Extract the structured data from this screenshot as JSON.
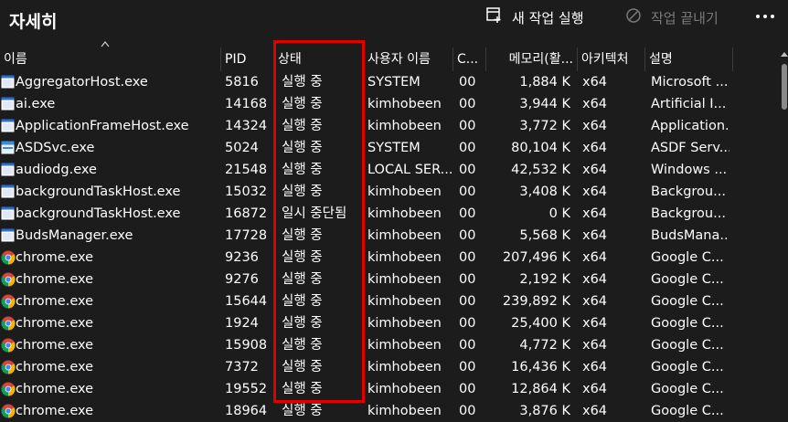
{
  "window": {
    "title": "자세히"
  },
  "toolbar": {
    "new_task_label": "새 작업 실행",
    "end_task_label": "작업 끝내기",
    "icons": {
      "new_task": "run-new-task-icon",
      "end_task": "end-task-icon",
      "more": "more-options-icon"
    }
  },
  "columns": {
    "name": "이름",
    "pid": "PID",
    "status": "상태",
    "user": "사용자 이름",
    "cpu": "C...",
    "memory": "메모리(활...",
    "arch": "아키텍처",
    "desc": "설명"
  },
  "processes": [
    {
      "name": "AggregatorHost.exe",
      "pid": "5816",
      "status": "실행 중",
      "user": "SYSTEM",
      "cpu": "00",
      "memory": "1,884 K",
      "arch": "x64",
      "desc": "Microsoft ...",
      "icon": "app-window-icon"
    },
    {
      "name": "ai.exe",
      "pid": "14168",
      "status": "실행 중",
      "user": "kimhobeen",
      "cpu": "00",
      "memory": "3,944 K",
      "arch": "x64",
      "desc": "Artificial I...",
      "icon": "app-window-icon"
    },
    {
      "name": "ApplicationFrameHost.exe",
      "pid": "14324",
      "status": "실행 중",
      "user": "kimhobeen",
      "cpu": "00",
      "memory": "3,772 K",
      "arch": "x64",
      "desc": "Application...",
      "icon": "app-window-icon"
    },
    {
      "name": "ASDSvc.exe",
      "pid": "5024",
      "status": "실행 중",
      "user": "SYSTEM",
      "cpu": "00",
      "memory": "80,104 K",
      "arch": "x64",
      "desc": "ASDF Serv...",
      "icon": "asdsvc-app-icon"
    },
    {
      "name": "audiodg.exe",
      "pid": "21548",
      "status": "실행 중",
      "user": "LOCAL SER...",
      "cpu": "00",
      "memory": "42,532 K",
      "arch": "x64",
      "desc": "Windows ...",
      "icon": "app-window-icon"
    },
    {
      "name": "backgroundTaskHost.exe",
      "pid": "15032",
      "status": "실행 중",
      "user": "kimhobeen",
      "cpu": "00",
      "memory": "3,408 K",
      "arch": "x64",
      "desc": "Backgrou...",
      "icon": "app-window-icon"
    },
    {
      "name": "backgroundTaskHost.exe",
      "pid": "16872",
      "status": "일시 중단됨",
      "user": "kimhobeen",
      "cpu": "00",
      "memory": "0 K",
      "arch": "x64",
      "desc": "Backgrou...",
      "icon": "app-window-icon"
    },
    {
      "name": "BudsManager.exe",
      "pid": "17728",
      "status": "실행 중",
      "user": "kimhobeen",
      "cpu": "00",
      "memory": "5,568 K",
      "arch": "x64",
      "desc": "BudsMana...",
      "icon": "app-window-icon"
    },
    {
      "name": "chrome.exe",
      "pid": "9236",
      "status": "실행 중",
      "user": "kimhobeen",
      "cpu": "00",
      "memory": "207,496 K",
      "arch": "x64",
      "desc": "Google C...",
      "icon": "chrome-icon"
    },
    {
      "name": "chrome.exe",
      "pid": "9276",
      "status": "실행 중",
      "user": "kimhobeen",
      "cpu": "00",
      "memory": "2,192 K",
      "arch": "x64",
      "desc": "Google C...",
      "icon": "chrome-icon"
    },
    {
      "name": "chrome.exe",
      "pid": "15644",
      "status": "실행 중",
      "user": "kimhobeen",
      "cpu": "00",
      "memory": "239,892 K",
      "arch": "x64",
      "desc": "Google C...",
      "icon": "chrome-icon"
    },
    {
      "name": "chrome.exe",
      "pid": "1924",
      "status": "실행 중",
      "user": "kimhobeen",
      "cpu": "00",
      "memory": "25,400 K",
      "arch": "x64",
      "desc": "Google C...",
      "icon": "chrome-icon"
    },
    {
      "name": "chrome.exe",
      "pid": "15908",
      "status": "실행 중",
      "user": "kimhobeen",
      "cpu": "00",
      "memory": "4,772 K",
      "arch": "x64",
      "desc": "Google C...",
      "icon": "chrome-icon"
    },
    {
      "name": "chrome.exe",
      "pid": "7372",
      "status": "실행 중",
      "user": "kimhobeen",
      "cpu": "00",
      "memory": "16,436 K",
      "arch": "x64",
      "desc": "Google C...",
      "icon": "chrome-icon"
    },
    {
      "name": "chrome.exe",
      "pid": "19552",
      "status": "실행 중",
      "user": "kimhobeen",
      "cpu": "00",
      "memory": "12,864 K",
      "arch": "x64",
      "desc": "Google C...",
      "icon": "chrome-icon"
    },
    {
      "name": "chrome.exe",
      "pid": "18964",
      "status": "실행 중",
      "user": "kimhobeen",
      "cpu": "00",
      "memory": "3,876 K",
      "arch": "x64",
      "desc": "Google C...",
      "icon": "chrome-icon"
    }
  ],
  "colors": {
    "background": "#1c1c1c",
    "text": "#ffffff",
    "disabled_text": "#7a7a7a",
    "highlight_box": "#e00000"
  }
}
